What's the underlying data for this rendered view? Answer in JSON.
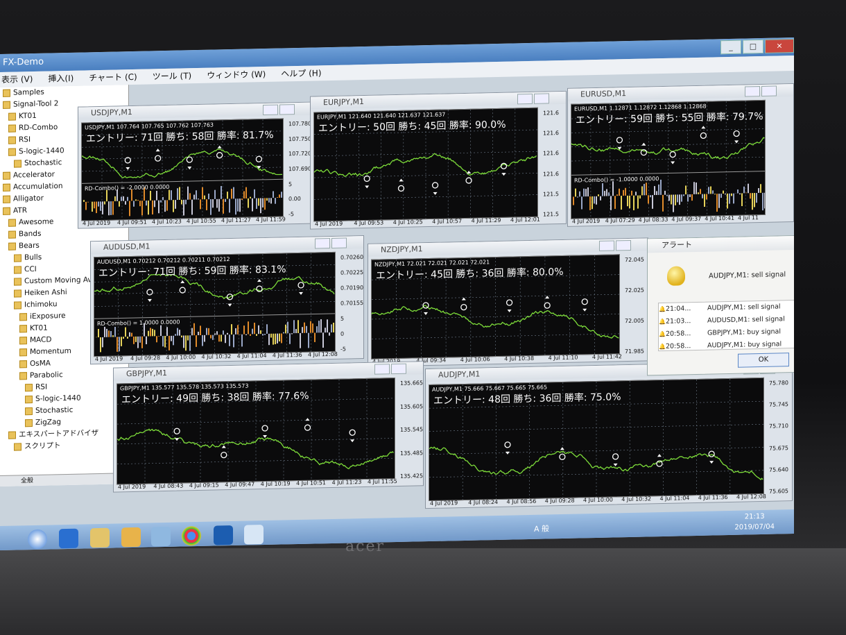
{
  "app_title": "FX-Demo",
  "menu": [
    "表示 (V)",
    "挿入(I)",
    "チャート (C)",
    "ツール (T)",
    "ウィンドウ (W)",
    "ヘルプ (H)"
  ],
  "navigator": {
    "items": [
      "Samples",
      "Signal-Tool 2",
      "KT01",
      "RD-Combo",
      "RSI",
      "S-logic-1440",
      "Stochastic",
      "Accelerator",
      "Accumulation",
      "Alligator",
      "ATR",
      "Awesome",
      "Bands",
      "Bears",
      "Bulls",
      "CCI",
      "Custom Moving Aver",
      "Heiken Ashi",
      "Ichimoku",
      "iExposure",
      "KT01",
      "MACD",
      "Momentum",
      "OsMA",
      "Parabolic",
      "RSI",
      "S-logic-1440",
      "Stochastic",
      "ZigZag",
      "エキスパートアドバイザ",
      "スクリプト"
    ],
    "tab": "全般"
  },
  "charts": [
    {
      "title": "USDJPY,M1",
      "header": "USDJPY,M1  107.764 107.765 107.762 107.763",
      "stats": "エントリー: 71回  勝ち: 58回  勝率: 81.7%",
      "indicator": "RD-Combo() = -2.0000 0.0000",
      "prices": [
        "107.780",
        "107.750",
        "107.720",
        "107.690",
        "5",
        "0.00",
        "-5"
      ],
      "times": [
        "4 Jul 2019",
        "4 Jul 09:51",
        "4 Jul 10:23",
        "4 Jul 10:55",
        "4 Jul 11:27",
        "4 Jul 11:59"
      ]
    },
    {
      "title": "EURJPY,M1",
      "header": "EURJPY,M1  121.640 121.640 121.637 121.637",
      "stats": "エントリー: 50回  勝ち: 45回  勝率: 90.0%",
      "indicator": "",
      "prices": [
        "121.6",
        "121.6",
        "121.6",
        "121.6",
        "121.5",
        "121.5"
      ],
      "times": [
        "4 Jul 2019",
        "4 Jul 09:53",
        "4 Jul 10:25",
        "4 Jul 10:57",
        "4 Jul 11:29",
        "4 Jul 12:01"
      ]
    },
    {
      "title": "EURUSD,M1",
      "header": "EURUSD,M1  1.12871 1.12872 1.12868 1.12868",
      "stats": "エントリー: 59回  勝ち: 55回  勝率: 79.7%",
      "indicator": "RD-Combo() = -1.0000 0.0000",
      "prices": [],
      "times": [
        "4 Jul 2019",
        "4 Jul 07:29",
        "4 Jul 08:33",
        "4 Jul 09:37",
        "4 Jul 10:41",
        "4 Jul 11"
      ]
    },
    {
      "title": "AUDUSD,M1",
      "header": "AUDUSD,M1  0.70212 0.70212 0.70211 0.70212",
      "stats": "エントリー: 71回  勝ち: 59回  勝率: 83.1%",
      "indicator": "RD-Combo() = 1.0000 0.0000",
      "prices": [
        "0.70260",
        "0.70225",
        "0.70190",
        "0.70155",
        "5",
        "0",
        "-5"
      ],
      "times": [
        "4 Jul 2019",
        "4 Jul 09:28",
        "4 Jul 10:00",
        "4 Jul 10:32",
        "4 Jul 11:04",
        "4 Jul 11:36",
        "4 Jul 12:08"
      ]
    },
    {
      "title": "NZDJPY,M1",
      "header": "NZDJPY,M1  72.021 72.021 72.021 72.021",
      "stats": "エントリー: 45回  勝ち: 36回  勝率: 80.0%",
      "indicator": "",
      "prices": [
        "72.045",
        "72.025",
        "72.005",
        "71.985"
      ],
      "times": [
        "4 Jul 2019",
        "4 Jul 09:34",
        "4 Jul 10:06",
        "4 Jul 10:38",
        "4 Jul 11:10",
        "4 Jul 11:42"
      ]
    },
    {
      "title": "GBPJPY,M1",
      "header": "GBPJPY,M1  135.577 135.578 135.573 135.573",
      "stats": "エントリー: 49回  勝ち: 38回  勝率: 77.6%",
      "indicator": "",
      "prices": [
        "135.665",
        "135.605",
        "135.545",
        "135.485",
        "135.425"
      ],
      "times": [
        "4 Jul 2019",
        "4 Jul 08:43",
        "4 Jul 09:15",
        "4 Jul 09:47",
        "4 Jul 10:19",
        "4 Jul 10:51",
        "4 Jul 11:23",
        "4 Jul 11:55"
      ]
    },
    {
      "title": "AUDJPY,M1",
      "header": "AUDJPY,M1  75.666 75.667 75.665 75.665",
      "stats": "エントリー: 48回  勝ち: 36回  勝率: 75.0%",
      "indicator": "",
      "prices": [
        "75.780",
        "75.745",
        "75.710",
        "75.675",
        "75.640",
        "75.605"
      ],
      "times": [
        "4 Jul 2019",
        "4 Jul 08:24",
        "4 Jul 08:56",
        "4 Jul 09:28",
        "4 Jul 10:00",
        "4 Jul 10:32",
        "4 Jul 11:04",
        "4 Jul 11:36",
        "4 Jul 12:08"
      ]
    }
  ],
  "alert": {
    "title": "アラート",
    "message": "AUDJPY,M1: sell signal",
    "rows": [
      {
        "time": "21:04...",
        "text": "AUDJPY,M1: sell signal"
      },
      {
        "time": "21:03...",
        "text": "AUDUSD,M1: sell signal"
      },
      {
        "time": "20:58...",
        "text": "GBPJPY,M1: buy signal"
      },
      {
        "time": "20:58...",
        "text": "AUDJPY,M1: buy signal"
      }
    ],
    "ok_label": "OK"
  },
  "hidden_tab": "EURUSD,M1",
  "taskbar": {
    "time": "21:13",
    "date": "2019/07/04",
    "ime": "A 般"
  },
  "laptop_brand": "acer",
  "colors": {
    "price_line": "#7ddc3a",
    "chart_bg": "#0b0b0c",
    "grid": "#6e7b8a"
  }
}
